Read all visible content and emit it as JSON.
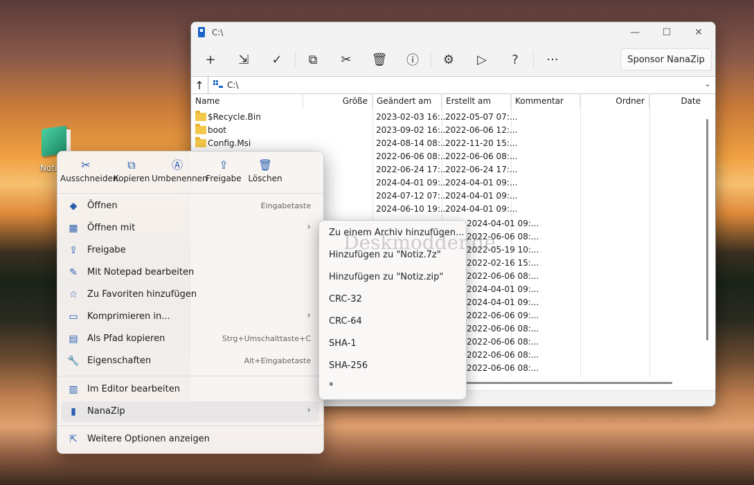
{
  "desktop": {
    "icon_label": "Noti"
  },
  "window": {
    "title": "C:\\",
    "controls": {
      "minimize": "—",
      "maximize": "☐",
      "close": "✕"
    },
    "toolbar": {
      "add": "+",
      "extract": "⇲",
      "test": "✓",
      "copy": "⧉",
      "move": "✂",
      "delete": "🗑",
      "info": "ⓘ",
      "settings": "⚙",
      "run": "▷",
      "help": "?",
      "more": "···",
      "sponsor_label": "Sponsor NanaZip"
    },
    "address": {
      "up": "↑",
      "path": "C:\\",
      "dropdown": "⌄"
    },
    "columns": {
      "name": "Name",
      "size": "Größe",
      "modified": "Geändert am",
      "created": "Erstellt am",
      "comment": "Kommentar",
      "folders": "Ordner",
      "files": "Date"
    },
    "rows": [
      {
        "name": "$Recycle.Bin",
        "modified": "2023-02-03 16:...",
        "created": "2022-05-07 07:..."
      },
      {
        "name": "boot",
        "modified": "2023-09-02 16:...",
        "created": "2022-06-06 12:..."
      },
      {
        "name": "Config.Msi",
        "modified": "2024-08-14 08:...",
        "created": "2022-11-20 15:..."
      },
      {
        "name": "",
        "modified": "2022-06-06 08:...",
        "created": "2022-06-06 08:..."
      },
      {
        "name": "",
        "modified": "2022-06-24 17:...",
        "created": "2022-06-24 17:..."
      },
      {
        "name": "",
        "modified": "2024-04-01 09:...",
        "created": "2024-04-01 09:..."
      },
      {
        "name": "",
        "modified": "2024-07-12 07:...",
        "created": "2024-04-01 09:..."
      },
      {
        "name": "",
        "modified": "2024-06-10 19:...",
        "created": "2024-04-01 09:..."
      }
    ],
    "right_created": [
      "2024-04-01 09:...",
      "2022-06-06 08:...",
      "2022-05-19 10:...",
      "2022-02-16 15:...",
      "2022-06-06 08:...",
      "2024-04-01 09:...",
      "2024-04-01 09:...",
      "2022-06-06 09:...",
      "2022-06-06 08:...",
      "2022-06-06 08:...",
      "2022-06-06 08:...",
      "2022-06-06 08:..."
    ]
  },
  "context_menu": {
    "quick_actions": [
      {
        "icon": "✂",
        "label": "Ausschneiden"
      },
      {
        "icon": "⧉",
        "label": "Kopieren"
      },
      {
        "icon": "Ⓐ",
        "label": "Umbenennen"
      },
      {
        "icon": "⇪",
        "label": "Freigabe"
      },
      {
        "icon": "🗑",
        "label": "Löschen"
      }
    ],
    "items": [
      {
        "icon": "◆",
        "label": "Öffnen",
        "shortcut": "Eingabetaste"
      },
      {
        "icon": "▦",
        "label": "Öffnen mit",
        "arrow": "›"
      },
      {
        "icon": "⇪",
        "label": "Freigabe"
      },
      {
        "icon": "✎",
        "label": "Mit Notepad bearbeiten"
      },
      {
        "icon": "☆",
        "label": "Zu Favoriten hinzufügen"
      },
      {
        "icon": "▭",
        "label": "Komprimieren in...",
        "arrow": "›"
      },
      {
        "icon": "▤",
        "label": "Als Pfad kopieren",
        "shortcut": "Strg+Umschalttaste+C"
      },
      {
        "icon": "🔧",
        "label": "Eigenschaften",
        "shortcut": "Alt+Eingabetaste"
      },
      {
        "icon": "▥",
        "label": "Im Editor bearbeiten"
      },
      {
        "icon": "▮",
        "label": "NanaZip",
        "arrow": "›"
      },
      {
        "icon": "⇱",
        "label": "Weitere Optionen anzeigen"
      }
    ]
  },
  "submenu": {
    "items": [
      "Zu einem Archiv hinzufügen...",
      "Hinzufügen zu \"Notiz.7z\"",
      "Hinzufügen zu \"Notiz.zip\"",
      "CRC-32",
      "CRC-64",
      "SHA-1",
      "SHA-256",
      "*"
    ],
    "watermark": "Deskmodder.de"
  },
  "colors": {
    "accent": "#2a5fb0",
    "folder": "#f4c94a"
  }
}
